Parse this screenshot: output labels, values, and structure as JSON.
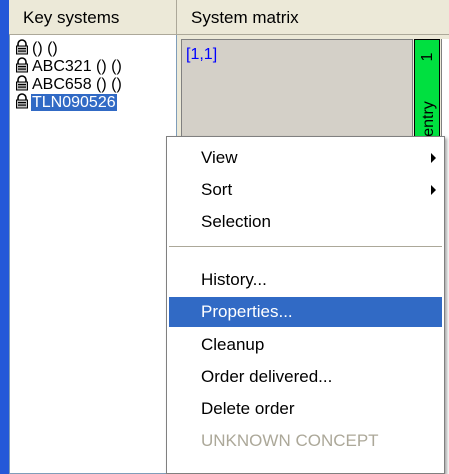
{
  "header": {
    "col_key_systems": "Key systems",
    "col_system_matrix": "System matrix"
  },
  "keylist": {
    "items": [
      {
        "label": "() ()",
        "icon": "padlock-icon",
        "selected": false
      },
      {
        "label": "ABC321 () ()",
        "icon": "padlock-icon",
        "selected": false
      },
      {
        "label": "ABC658 () ()",
        "icon": "padlock-icon",
        "selected": false
      },
      {
        "label": "TLN090526",
        "icon": "padlock-icon",
        "selected": true
      }
    ]
  },
  "matrix": {
    "cell_coord": "[1,1]",
    "column_number": "1",
    "column_label": "entry"
  },
  "context_menu": {
    "items": [
      {
        "label": "View",
        "submenu": true
      },
      {
        "label": "Sort",
        "submenu": true
      },
      {
        "label": "Selection"
      },
      {
        "label": "History..."
      },
      {
        "label": "Properties...",
        "highlighted": true
      },
      {
        "label": "Cleanup"
      },
      {
        "label": "Order delivered..."
      },
      {
        "label": "Delete order"
      },
      {
        "label": "UNKNOWN CONCEPT",
        "disabled": true
      }
    ]
  },
  "colors": {
    "selection": "#316ac5",
    "column_green": "#00e040",
    "coord_text": "#0000ff",
    "left_stripe": "#2458d8"
  }
}
